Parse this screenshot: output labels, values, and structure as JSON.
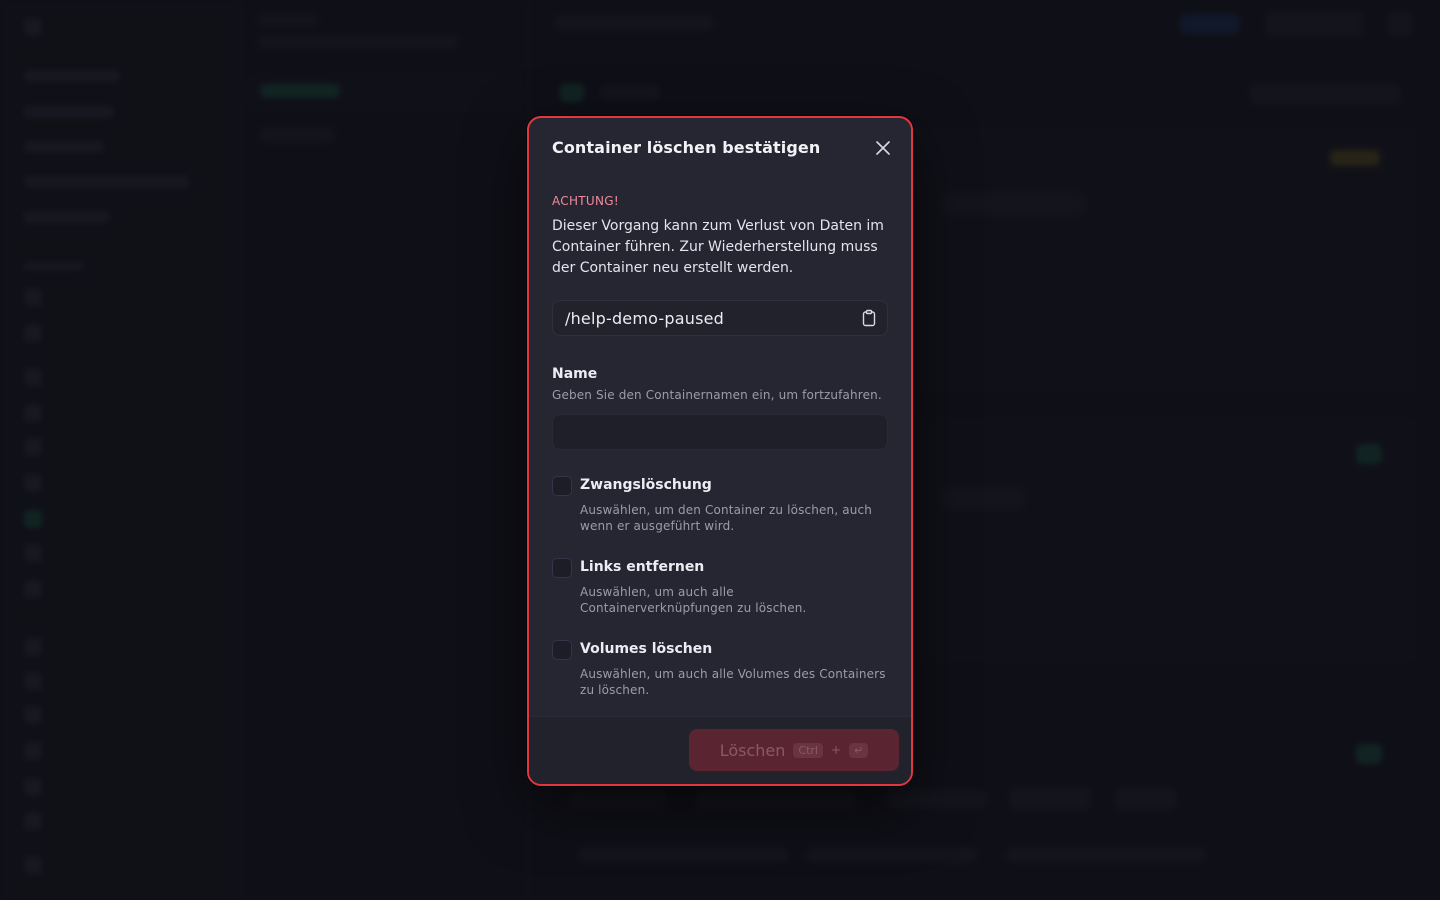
{
  "modal": {
    "title": "Container löschen bestätigen",
    "warning_title": "ACHTUNG!",
    "warning_text": "Dieser Vorgang kann zum Verlust von Daten im Container führen. Zur Wiederherstellung muss der Container neu erstellt werden.",
    "container_path": "/help-demo-paused",
    "name_label": "Name",
    "name_hint": "Geben Sie den Containernamen ein, um fortzufahren.",
    "name_value": "",
    "options": [
      {
        "label": "Zwangslöschung",
        "description": "Auswählen, um den Container zu löschen, auch wenn er ausgeführt wird.",
        "checked": false
      },
      {
        "label": "Links entfernen",
        "description": "Auswählen, um auch alle Containerverknüpfungen zu löschen.",
        "checked": false
      },
      {
        "label": "Volumes löschen",
        "description": "Auswählen, um auch alle Volumes des Containers zu löschen.",
        "checked": false
      }
    ],
    "delete_button": {
      "label": "Löschen",
      "shortcut_key1": "Ctrl",
      "shortcut_plus": "+",
      "shortcut_key2": "↵",
      "enabled": false
    }
  },
  "icons": {
    "close": "close-icon",
    "copy": "clipboard-icon"
  },
  "colors": {
    "danger_border": "#e0383e",
    "warning_text": "#f08a9a",
    "modal_bg": "#262633",
    "page_bg": "#17171f"
  }
}
